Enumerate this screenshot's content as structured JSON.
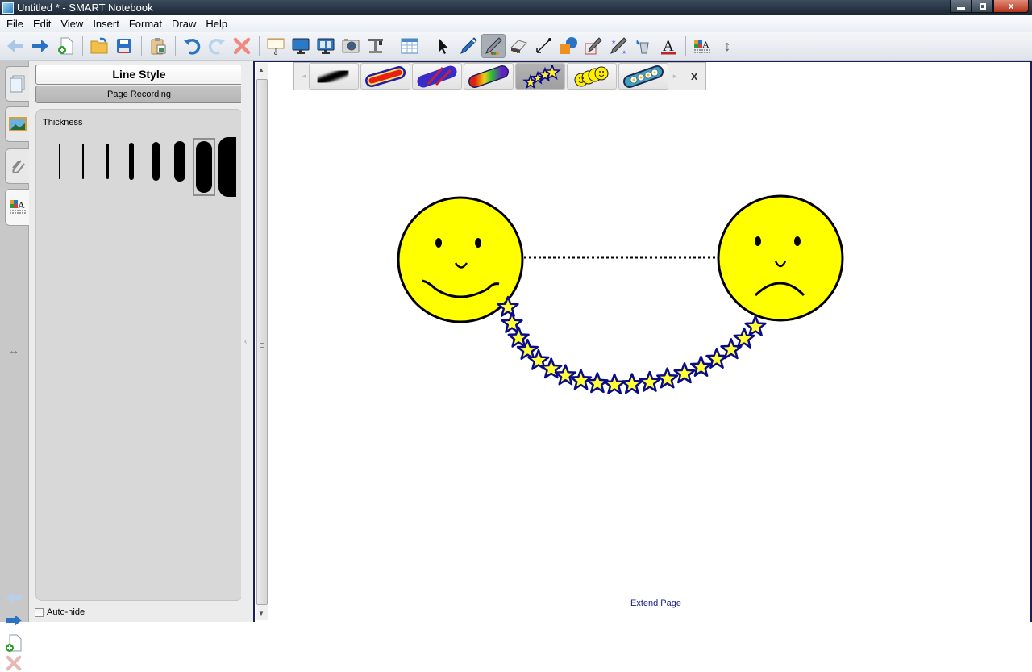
{
  "window": {
    "title": "Untitled * - SMART Notebook",
    "app_icon": "smart-notebook-icon"
  },
  "window_controls": {
    "minimize": "minimize-icon",
    "maximize": "restore-icon",
    "close": "close-icon",
    "close_glyph": "x"
  },
  "menubar": {
    "items": [
      {
        "label": "File"
      },
      {
        "label": "Edit"
      },
      {
        "label": "View"
      },
      {
        "label": "Insert"
      },
      {
        "label": "Format"
      },
      {
        "label": "Draw"
      },
      {
        "label": "Help"
      }
    ]
  },
  "toolbar": {
    "buttons": [
      {
        "name": "previous-page",
        "icon": "arrow-left-icon",
        "enabled": false
      },
      {
        "name": "next-page",
        "icon": "arrow-right-icon",
        "enabled": true
      },
      {
        "name": "add-page",
        "icon": "add-page-icon"
      },
      {
        "name": "open",
        "icon": "open-folder-icon"
      },
      {
        "name": "save",
        "icon": "save-icon"
      },
      {
        "name": "paste",
        "icon": "paste-icon"
      },
      {
        "name": "undo",
        "icon": "undo-icon"
      },
      {
        "name": "redo",
        "icon": "redo-icon",
        "enabled": false
      },
      {
        "name": "delete",
        "icon": "delete-icon"
      },
      {
        "name": "screen-shade",
        "icon": "screen-shade-icon"
      },
      {
        "name": "full-screen",
        "icon": "full-screen-icon"
      },
      {
        "name": "dual-page",
        "icon": "dual-page-icon"
      },
      {
        "name": "screen-capture",
        "icon": "camera-icon"
      },
      {
        "name": "document-camera",
        "icon": "document-camera-icon"
      },
      {
        "name": "table",
        "icon": "table-icon"
      },
      {
        "name": "select",
        "icon": "pointer-icon"
      },
      {
        "name": "pen",
        "icon": "pen-icon"
      },
      {
        "name": "creative-pen",
        "icon": "creative-pen-icon",
        "active": true
      },
      {
        "name": "eraser",
        "icon": "eraser-icon"
      },
      {
        "name": "line",
        "icon": "line-icon"
      },
      {
        "name": "shapes",
        "icon": "shapes-icon"
      },
      {
        "name": "shape-recognition-pen",
        "icon": "shape-pen-icon"
      },
      {
        "name": "magic-pen",
        "icon": "magic-pen-icon"
      },
      {
        "name": "fill",
        "icon": "fill-bucket-icon"
      },
      {
        "name": "text",
        "icon": "text-icon",
        "glyph": "A"
      },
      {
        "name": "properties",
        "icon": "properties-icon"
      },
      {
        "name": "move-toolbar",
        "icon": "updown-arrow-icon",
        "glyph": "↕"
      }
    ]
  },
  "side_tabs": [
    {
      "name": "page-sorter",
      "icon": "page-sorter-icon"
    },
    {
      "name": "gallery",
      "icon": "gallery-icon"
    },
    {
      "name": "attachments",
      "icon": "paperclip-icon"
    },
    {
      "name": "properties",
      "icon": "properties-icon",
      "active": true
    }
  ],
  "side_bottom": {
    "resize_glyph": "↔"
  },
  "panel": {
    "title": "Line Style",
    "page_recording": "Page Recording",
    "thickness_label": "Thickness",
    "thickness_levels": [
      1,
      2,
      3,
      4,
      5,
      6,
      7,
      8
    ],
    "selected_thickness_index": 6,
    "autohide_label": "Auto-hide",
    "autohide_checked": false
  },
  "pen_tray": {
    "styles": [
      {
        "name": "calligraphic-black"
      },
      {
        "name": "red-yellow-outline"
      },
      {
        "name": "purple-striped"
      },
      {
        "name": "rainbow"
      },
      {
        "name": "stars",
        "active": true
      },
      {
        "name": "smiley-faces"
      },
      {
        "name": "daisies"
      }
    ],
    "close_label": "x",
    "left_arrow": "◂",
    "right_arrow": "▸"
  },
  "canvas": {
    "shapes": [
      {
        "name": "happy-face",
        "fill": "#ffff00"
      },
      {
        "name": "sad-face",
        "fill": "#ffff00"
      },
      {
        "name": "dotted-connector-line"
      },
      {
        "name": "star-stroke",
        "star_count": 19,
        "star_fill": "#ffff33",
        "star_stroke": "#0a0a8c"
      }
    ],
    "extend_page_link": "Extend Page"
  },
  "colors": {
    "accent": "#1d1e57",
    "face_yellow": "#ffff00",
    "star_blue": "#0a0a8c"
  }
}
